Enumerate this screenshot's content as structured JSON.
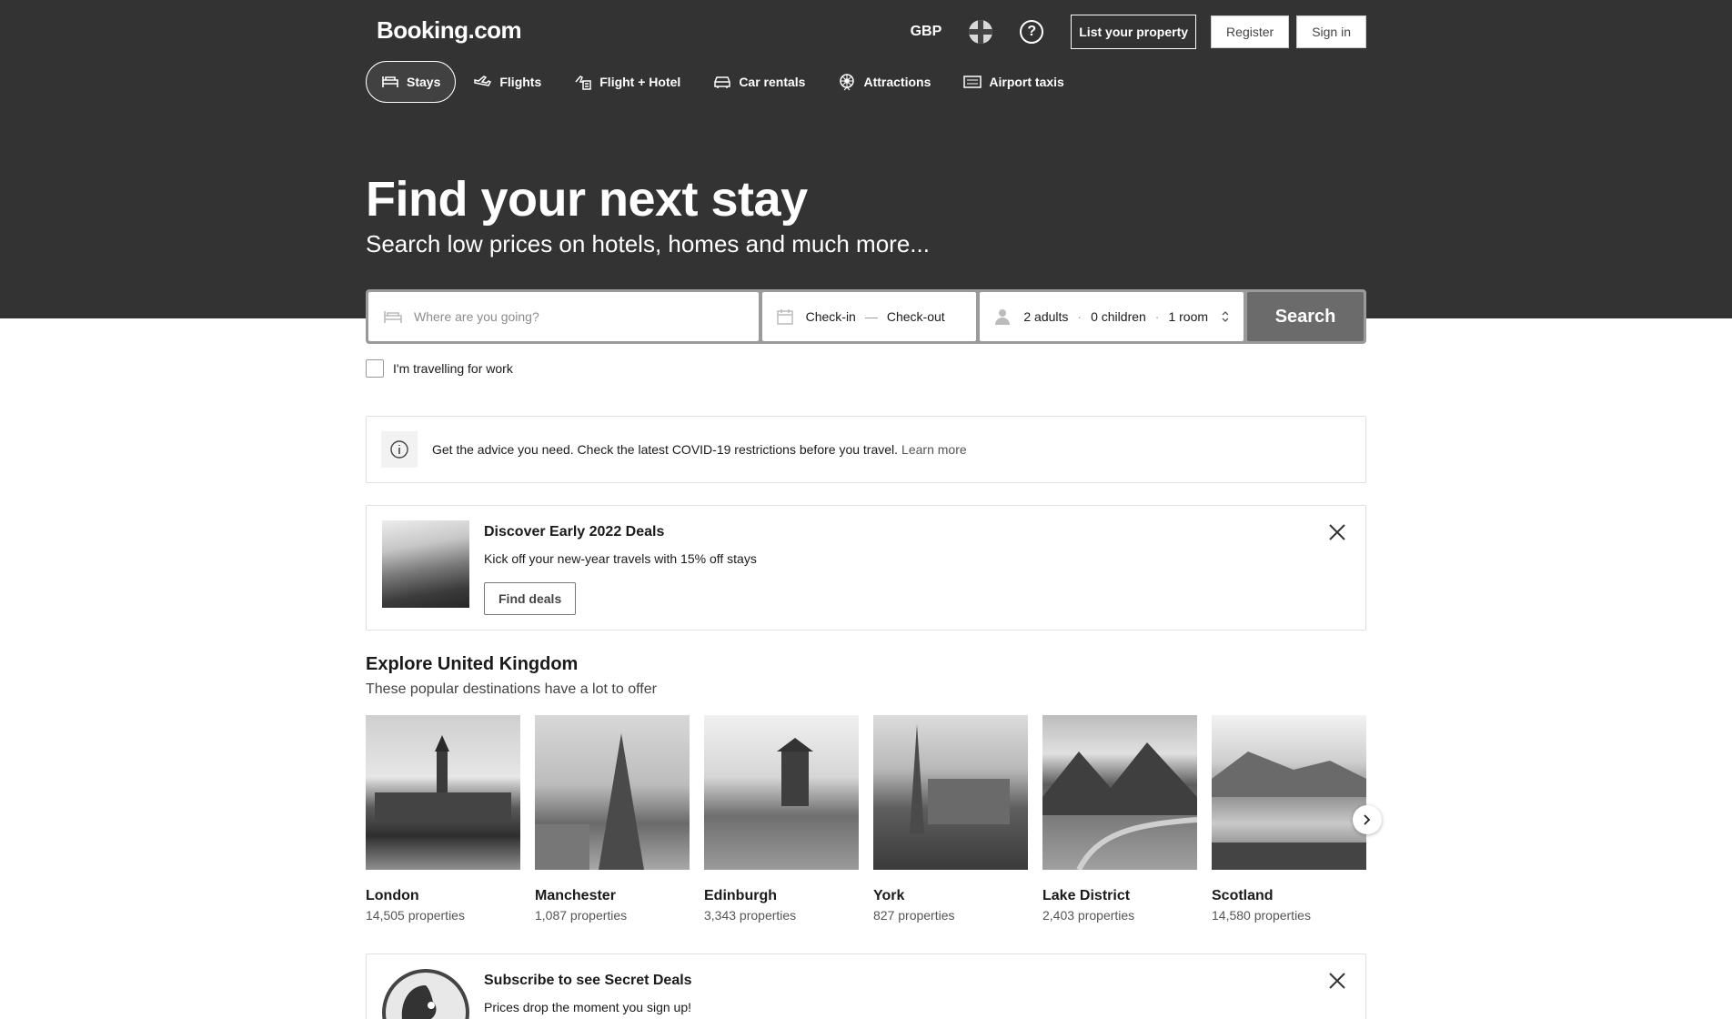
{
  "header": {
    "logo": "Booking.com",
    "currency": "GBP",
    "help_label": "?",
    "list_property": "List your property",
    "register": "Register",
    "sign_in": "Sign in"
  },
  "nav": {
    "tabs": [
      {
        "label": "Stays",
        "icon": "bed-icon",
        "active": true
      },
      {
        "label": "Flights",
        "icon": "plane-icon"
      },
      {
        "label": "Flight + Hotel",
        "icon": "flight-hotel-icon"
      },
      {
        "label": "Car rentals",
        "icon": "car-icon"
      },
      {
        "label": "Attractions",
        "icon": "attractions-icon"
      },
      {
        "label": "Airport taxis",
        "icon": "taxi-icon"
      }
    ]
  },
  "hero": {
    "title": "Find your next stay",
    "subtitle": "Search low prices on hotels, homes and much more..."
  },
  "search": {
    "destination_placeholder": "Where are you going?",
    "check_in": "Check-in",
    "dash": "—",
    "check_out": "Check-out",
    "adults": "2 adults",
    "children": "0 children",
    "rooms": "1 room",
    "dot": "·",
    "button": "Search",
    "work_label": "I'm travelling for work"
  },
  "covid": {
    "text": "Get the advice you need. Check the latest COVID-19 restrictions before you travel.",
    "link": "Learn more"
  },
  "deal": {
    "title": "Discover Early 2022 Deals",
    "text": "Kick off your new-year travels with 15% off stays",
    "button": "Find deals"
  },
  "explore": {
    "title": "Explore United Kingdom",
    "subtitle": "These popular destinations have a lot to offer",
    "destinations": [
      {
        "name": "London",
        "count": "14,505 properties"
      },
      {
        "name": "Manchester",
        "count": "1,087 properties"
      },
      {
        "name": "Edinburgh",
        "count": "3,343 properties"
      },
      {
        "name": "York",
        "count": "827 properties"
      },
      {
        "name": "Lake District",
        "count": "2,403 properties"
      },
      {
        "name": "Scotland",
        "count": "14,580 properties"
      }
    ]
  },
  "subscribe": {
    "title": "Subscribe to see Secret Deals",
    "text": "Prices drop the moment you sign up!"
  },
  "colors": {
    "header_bg": "#333333",
    "search_button": "#6b6b6b",
    "page_bg": "#ffffff"
  }
}
